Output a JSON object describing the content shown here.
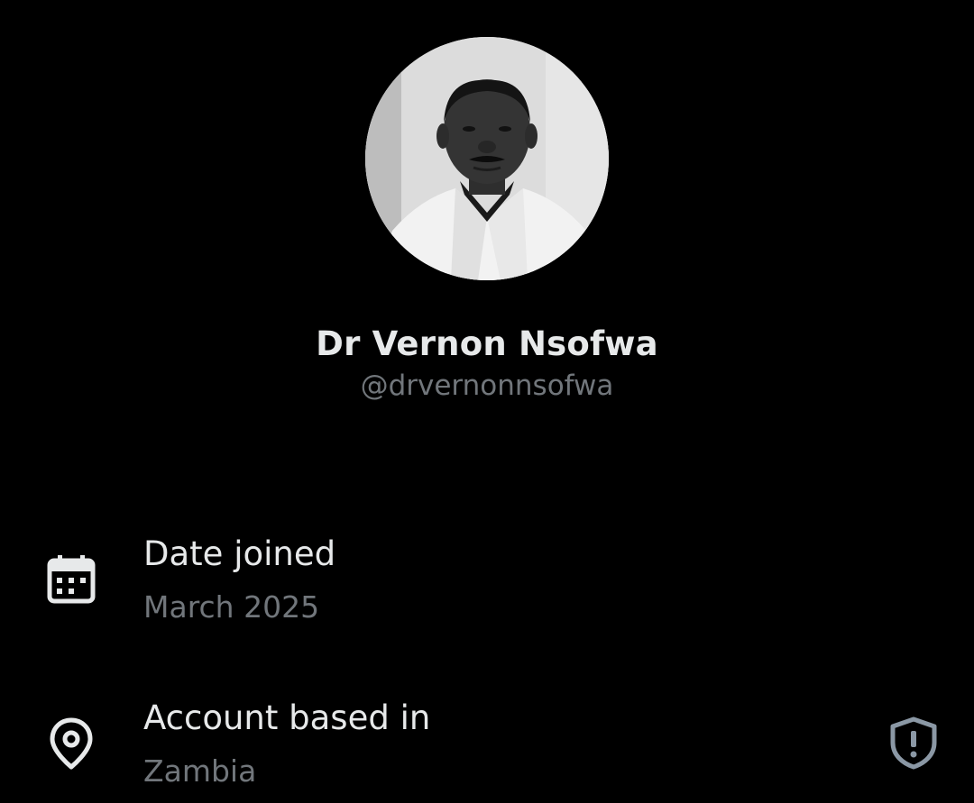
{
  "profile": {
    "display_name": "Dr Vernon Nsofwa",
    "handle": "@drvernonnsofwa"
  },
  "info": {
    "date_joined": {
      "label": "Date joined",
      "value": "March 2025",
      "icon": "calendar-icon"
    },
    "location": {
      "label": "Account based in",
      "value": "Zambia",
      "icon": "location-pin-icon",
      "action_icon": "shield-alert-icon"
    }
  },
  "colors": {
    "background": "#000000",
    "primary_text": "#e7e9ea",
    "secondary_text": "#71767b"
  }
}
